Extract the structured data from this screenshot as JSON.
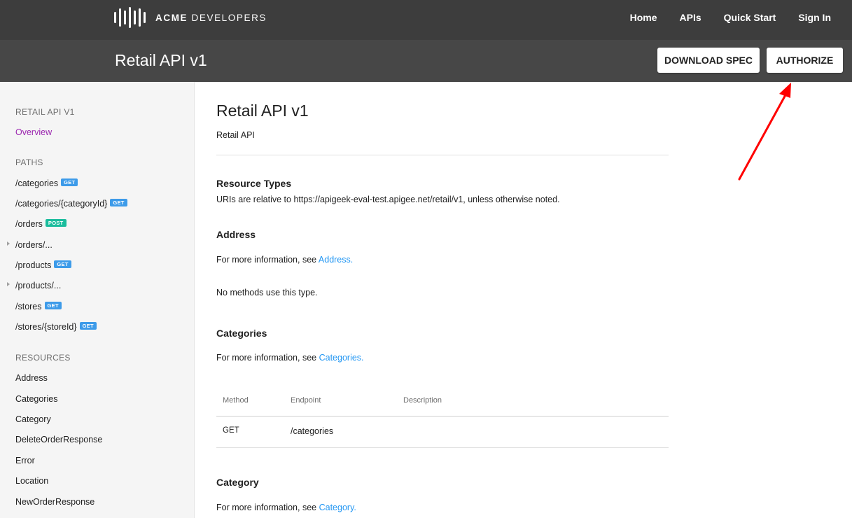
{
  "brand": {
    "name_bold": "ACME",
    "name_rest": " DEVELOPERS"
  },
  "nav": {
    "home": "Home",
    "apis": "APIs",
    "quick_start": "Quick Start",
    "sign_in": "Sign In"
  },
  "header": {
    "title": "Retail API v1",
    "download_label": "DOWNLOAD SPEC",
    "authorize_label": "AUTHORIZE"
  },
  "sidebar": {
    "api_heading": "RETAIL API V1",
    "overview": "Overview",
    "paths_heading": "PATHS",
    "paths": [
      {
        "label": "/categories",
        "method": "GET"
      },
      {
        "label": "/categories/{categoryId}",
        "method": "GET"
      },
      {
        "label": "/orders",
        "method": "POST"
      },
      {
        "label": "/orders/...",
        "method": ""
      },
      {
        "label": "/products",
        "method": "GET"
      },
      {
        "label": "/products/...",
        "method": ""
      },
      {
        "label": "/stores",
        "method": "GET"
      },
      {
        "label": "/stores/{storeId}",
        "method": "GET"
      }
    ],
    "resources_heading": "RESOURCES",
    "resources": [
      "Address",
      "Categories",
      "Category",
      "DeleteOrderResponse",
      "Error",
      "Location",
      "NewOrderResponse"
    ]
  },
  "main": {
    "title": "Retail API v1",
    "subtitle": "Retail API",
    "resource_types": {
      "title": "Resource Types",
      "text": "URIs are relative to https://apigeek-eval-test.apigee.net/retail/v1, unless otherwise noted."
    },
    "address": {
      "title": "Address",
      "info_prefix": "For more information, see ",
      "info_link": "Address.",
      "no_methods": "No methods use this type."
    },
    "categories": {
      "title": "Categories",
      "info_prefix": "For more information, see ",
      "info_link": "Categories.",
      "table": {
        "headers": [
          "Method",
          "Endpoint",
          "Description"
        ],
        "rows": [
          {
            "method": "GET",
            "endpoint": "/categories",
            "description": ""
          }
        ]
      }
    },
    "category": {
      "title": "Category",
      "info_prefix": "For more information, see ",
      "info_link": "Category."
    }
  },
  "colors": {
    "nav_bg": "#3d3d3d",
    "header_bg": "#474747",
    "link": "#2196f3",
    "active": "#9c27b0",
    "get_badge": "#3d9be9",
    "post_badge": "#1abc9c",
    "arrow": "#ff0000"
  }
}
